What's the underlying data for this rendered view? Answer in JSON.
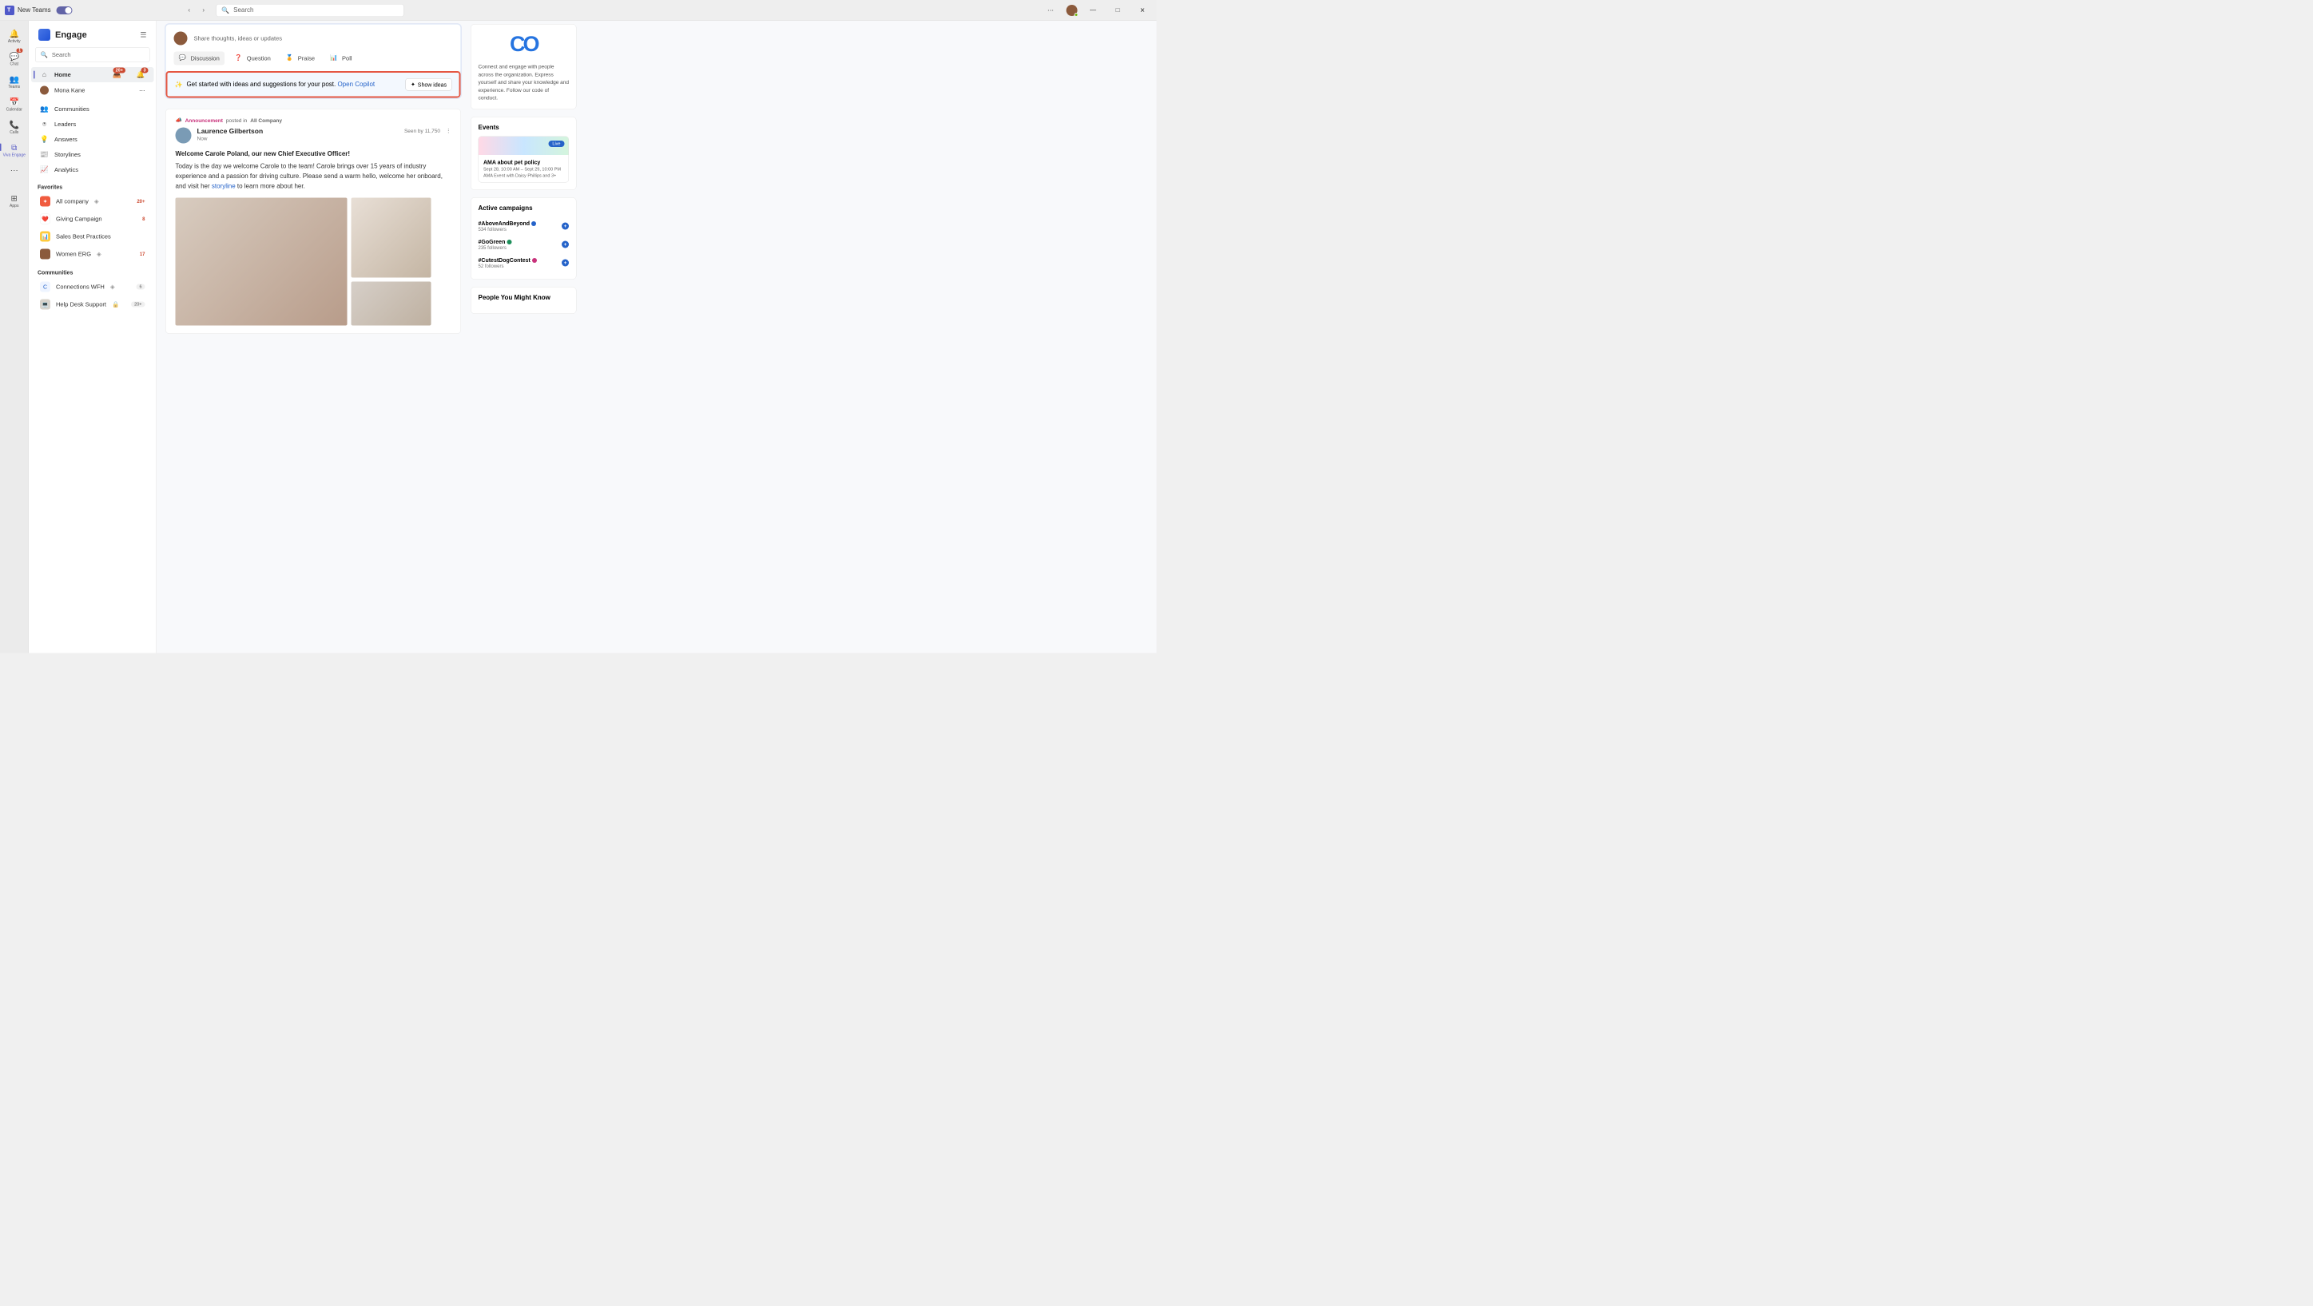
{
  "title_bar": {
    "app_label": "New Teams",
    "search_placeholder": "Search"
  },
  "rail": {
    "items": [
      {
        "label": "Activity"
      },
      {
        "label": "Chat",
        "badge": "1"
      },
      {
        "label": "Teams"
      },
      {
        "label": "Calendar"
      },
      {
        "label": "Calls"
      },
      {
        "label": "Viva Engage",
        "active": true
      },
      {
        "label": "Apps"
      }
    ]
  },
  "engage": {
    "app_name": "Engage",
    "search_placeholder": "Search",
    "nav": [
      {
        "label": "Home",
        "selected": true,
        "badges": [
          "20+",
          "3"
        ]
      },
      {
        "label": "Mona Kane"
      },
      {
        "label": "Communities"
      },
      {
        "label": "Leaders"
      },
      {
        "label": "Answers"
      },
      {
        "label": "Storylines"
      },
      {
        "label": "Analytics"
      }
    ],
    "favorites_header": "Favorites",
    "favorites": [
      {
        "label": "All company",
        "count": "20+",
        "ico_bg": "#f05b3f"
      },
      {
        "label": "Giving Campaign",
        "count": "8",
        "ico_bg": "#fff"
      },
      {
        "label": "Sales Best Practices",
        "ico_bg": "#ffcb3d"
      },
      {
        "label": "Women ERG",
        "count": "17",
        "ico_bg": "#8b5a3c"
      }
    ],
    "communities_header": "Communities",
    "communities": [
      {
        "label": "Connections WFH",
        "count": "6",
        "ico_bg": "#eef4ff"
      },
      {
        "label": "Help Desk Support",
        "count": "20+",
        "ico_bg": "#d9d4cc"
      }
    ]
  },
  "compose": {
    "placeholder": "Share thoughts, ideas or updates",
    "tabs": [
      {
        "label": "Discussion",
        "active": true,
        "color": "#f08c2e"
      },
      {
        "label": "Question",
        "color": "#2563c9"
      },
      {
        "label": "Praise",
        "color": "#e055a5"
      },
      {
        "label": "Poll",
        "color": "#1d8f5a"
      }
    ]
  },
  "copilot": {
    "text": "Get started with ideas and suggestions for your post. ",
    "link": "Open Copilot",
    "button": "Show ideas"
  },
  "post": {
    "tag": "Announcement",
    "posted_in_label": "posted in",
    "community": "All Company",
    "author": "Laurence Gilbertson",
    "time": "Now",
    "seen_by": "Seen by 11,750",
    "title": "Welcome Carole Poland, our new Chief Executive Officer!",
    "body_pre": "Today is the day we welcome Carole to the team! Carole brings over 15 years of industry experience and a passion for driving culture. Please send a warm hello, welcome her onboard, and visit her ",
    "body_link": "storyline",
    "body_post": " to learn more about her."
  },
  "right": {
    "brand_text": "Connect and engage with people across the organization. Express yourself and share your knowledge and experience. Follow our code of conduct.",
    "events_header": "Events",
    "event": {
      "live": "Live",
      "title": "AMA about pet policy",
      "date": "Sept 28, 10:00 AM – Sept 29, 10:00 PM",
      "sub": "AMA Event with Daisy Phillips and 3+"
    },
    "campaigns_header": "Active campaigns",
    "campaigns": [
      {
        "name": "#AboveAndBeyond",
        "followers": "534 followers",
        "dot": "#2563c9"
      },
      {
        "name": "#GoGreen",
        "followers": "235 followers",
        "dot": "#1d8f5a"
      },
      {
        "name": "#CutestDogContest",
        "followers": "52 followers",
        "dot": "#c8327b"
      }
    ],
    "people_header": "People You Might Know"
  }
}
